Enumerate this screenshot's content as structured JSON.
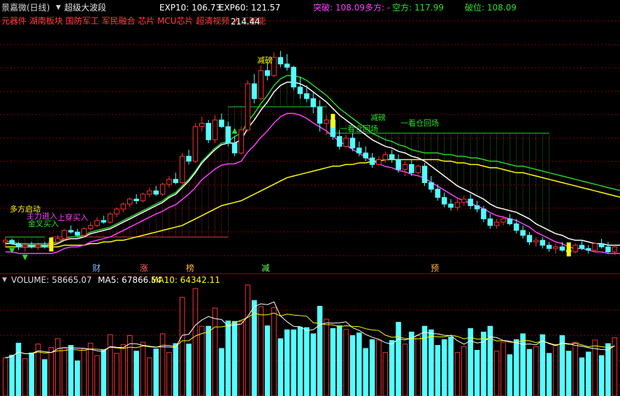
{
  "header": {
    "stock": "景嘉微(日线)",
    "indicator": "超级大波段",
    "exp10": "EXP10: 106.73",
    "exp60": "EXP60: 121.57",
    "breakout_label": "突破: 108.09",
    "long_label": "多方: -",
    "short_label": "空方: 117.99",
    "breakdown_label": "破位: 108.09",
    "concepts": "元器件 湖南板块 国防军工 军民融合 芯片 MCU芯片 超清视频 人工智能"
  },
  "price_chart": {
    "high_label": "214.44",
    "annotations": [
      "多方启动",
      "主力进入",
      "金叉买入",
      "上穿买入",
      "减磅",
      "减磅",
      "一看仓回场",
      "一看仓回场"
    ],
    "events": [
      "财",
      "涨",
      "榜",
      "减",
      "预"
    ]
  },
  "volume_chart": {
    "title": "VOLUME: 58665.07",
    "ma5_label": "MA5: 67866.54",
    "ma10_label": "MA10: 64342.11"
  },
  "colors": {
    "up": "#ff3232",
    "down": "#54ffff",
    "exp10": "#ffffff",
    "mid": "#ff40ff",
    "exp60": "#ffff00",
    "green": "#28d228",
    "grid": "#8b0000",
    "label_yellow": "#ffff00",
    "label_magenta": "#ff40ff",
    "label_green": "#28e028"
  },
  "chart_data": {
    "type": "candlestick",
    "title": "超级大波段",
    "price_range": [
      88,
      230
    ],
    "volume_range": [
      0,
      125000
    ],
    "candles": [
      [
        98,
        101,
        95,
        99
      ],
      [
        99,
        100,
        96,
        97
      ],
      [
        97,
        98,
        93,
        95
      ],
      [
        95,
        97,
        92,
        96
      ],
      [
        96,
        98,
        94,
        95
      ],
      [
        95,
        97,
        93,
        96
      ],
      [
        96,
        98,
        94,
        95
      ],
      [
        95,
        99,
        94,
        98
      ],
      [
        98,
        102,
        97,
        100
      ],
      [
        100,
        106,
        99,
        105
      ],
      [
        105,
        108,
        103,
        104
      ],
      [
        104,
        106,
        101,
        102
      ],
      [
        102,
        107,
        101,
        106
      ],
      [
        106,
        110,
        105,
        108
      ],
      [
        108,
        113,
        107,
        111
      ],
      [
        111,
        114,
        109,
        110
      ],
      [
        110,
        116,
        109,
        115
      ],
      [
        115,
        119,
        113,
        118
      ],
      [
        118,
        122,
        116,
        121
      ],
      [
        121,
        125,
        119,
        124
      ],
      [
        124,
        127,
        121,
        123
      ],
      [
        123,
        128,
        122,
        127
      ],
      [
        127,
        131,
        125,
        129
      ],
      [
        129,
        132,
        126,
        127
      ],
      [
        127,
        134,
        126,
        133
      ],
      [
        133,
        138,
        131,
        136
      ],
      [
        136,
        140,
        133,
        134
      ],
      [
        134,
        152,
        133,
        150
      ],
      [
        150,
        154,
        145,
        147
      ],
      [
        147,
        170,
        146,
        168
      ],
      [
        168,
        174,
        165,
        170
      ],
      [
        170,
        172,
        158,
        160
      ],
      [
        160,
        175,
        158,
        172
      ],
      [
        172,
        176,
        167,
        168
      ],
      [
        168,
        171,
        156,
        158
      ],
      [
        158,
        162,
        150,
        152
      ],
      [
        152,
        168,
        151,
        166
      ],
      [
        166,
        196,
        165,
        194
      ],
      [
        194,
        200,
        182,
        185
      ],
      [
        185,
        205,
        184,
        202
      ],
      [
        202,
        208,
        196,
        199
      ],
      [
        199,
        213,
        198,
        210
      ],
      [
        210,
        214,
        204,
        206
      ],
      [
        206,
        212,
        202,
        204
      ],
      [
        204,
        205,
        190,
        192
      ],
      [
        192,
        198,
        185,
        188
      ],
      [
        188,
        193,
        183,
        185
      ],
      [
        185,
        189,
        176,
        180
      ],
      [
        180,
        184,
        165,
        170
      ],
      [
        170,
        175,
        163,
        172
      ],
      [
        172,
        174,
        160,
        162
      ],
      [
        162,
        166,
        154,
        156
      ],
      [
        156,
        163,
        155,
        161
      ],
      [
        161,
        164,
        153,
        155
      ],
      [
        155,
        159,
        150,
        152
      ],
      [
        152,
        156,
        147,
        149
      ],
      [
        149,
        152,
        143,
        145
      ],
      [
        145,
        150,
        144,
        148
      ],
      [
        148,
        153,
        146,
        151
      ],
      [
        151,
        154,
        146,
        148
      ],
      [
        148,
        151,
        140,
        142
      ],
      [
        142,
        147,
        138,
        145
      ],
      [
        145,
        148,
        138,
        140
      ],
      [
        140,
        145,
        139,
        144
      ],
      [
        144,
        146,
        132,
        134
      ],
      [
        134,
        138,
        128,
        130
      ],
      [
        130,
        133,
        123,
        125
      ],
      [
        125,
        128,
        119,
        121
      ],
      [
        121,
        124,
        117,
        119
      ],
      [
        119,
        124,
        117,
        122
      ],
      [
        122,
        126,
        120,
        124
      ],
      [
        124,
        127,
        118,
        120
      ],
      [
        120,
        123,
        116,
        118
      ],
      [
        118,
        120,
        110,
        112
      ],
      [
        112,
        115,
        106,
        108
      ],
      [
        108,
        112,
        106,
        110
      ],
      [
        110,
        114,
        108,
        112
      ],
      [
        112,
        115,
        108,
        109
      ],
      [
        109,
        112,
        103,
        105
      ],
      [
        105,
        108,
        100,
        102
      ],
      [
        102,
        104,
        96,
        98
      ],
      [
        98,
        101,
        95,
        99
      ],
      [
        99,
        101,
        94,
        96
      ],
      [
        96,
        98,
        92,
        94
      ],
      [
        94,
        97,
        91,
        95
      ],
      [
        95,
        98,
        92,
        93
      ],
      [
        93,
        96,
        90,
        92
      ],
      [
        92,
        97,
        91,
        96
      ],
      [
        96,
        99,
        93,
        94
      ],
      [
        94,
        96,
        91,
        93
      ],
      [
        93,
        98,
        92,
        97
      ],
      [
        97,
        100,
        94,
        95
      ],
      [
        95,
        98,
        91,
        92
      ],
      [
        92,
        96,
        90,
        95
      ]
    ],
    "exp10": [
      97,
      97,
      96,
      96,
      96,
      96,
      96,
      96,
      97,
      99,
      100,
      100,
      101,
      103,
      104,
      105,
      106,
      108,
      110,
      112,
      114,
      116,
      118,
      120,
      122,
      125,
      127,
      131,
      135,
      140,
      146,
      150,
      154,
      157,
      158,
      158,
      160,
      167,
      172,
      178,
      183,
      189,
      193,
      195,
      195,
      194,
      192,
      189,
      186,
      183,
      179,
      175,
      172,
      169,
      166,
      163,
      160,
      158,
      156,
      155,
      153,
      152,
      150,
      149,
      147,
      144,
      141,
      138,
      135,
      132,
      130,
      128,
      126,
      124,
      121,
      119,
      118,
      117,
      116,
      114,
      112,
      109,
      107,
      105,
      103,
      102,
      100,
      99,
      99,
      98,
      97,
      97,
      96,
      96,
      96,
      95
    ],
    "exp60": [
      95,
      95,
      95,
      95,
      95,
      95,
      95,
      95,
      95,
      96,
      96,
      96,
      96,
      97,
      97,
      98,
      98,
      99,
      99,
      100,
      101,
      102,
      103,
      104,
      105,
      106,
      107,
      108,
      110,
      112,
      114,
      116,
      118,
      120,
      121,
      122,
      123,
      125,
      127,
      129,
      131,
      133,
      135,
      137,
      138,
      139,
      140,
      141,
      142,
      143,
      144,
      144,
      145,
      145,
      146,
      146,
      147,
      147,
      148,
      148,
      148,
      148,
      148,
      148,
      148,
      148,
      148,
      147,
      147,
      146,
      146,
      145,
      145,
      144,
      143,
      143,
      142,
      141,
      140,
      140,
      139,
      138,
      137,
      136,
      135,
      134,
      133,
      132,
      131,
      130,
      129,
      128,
      127,
      126,
      125,
      124
    ]
  }
}
